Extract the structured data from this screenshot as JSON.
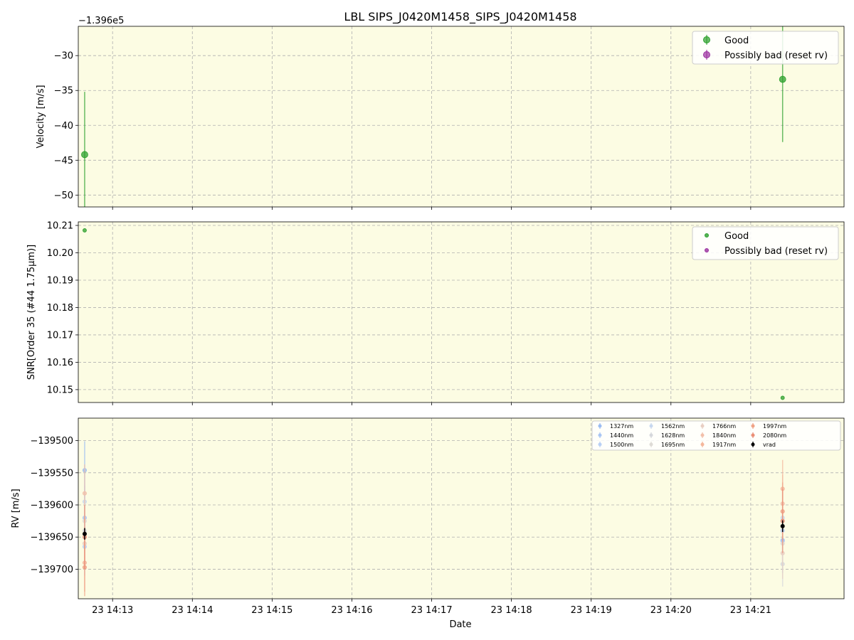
{
  "title": "LBL SIPS_J0420M1458_SIPS_J0420M1458",
  "xlabel": "Date",
  "x_ticks": [
    "23 14:13",
    "23 14:14",
    "23 14:15",
    "23 14:16",
    "23 14:17",
    "23 14:18",
    "23 14:19",
    "23 14:20",
    "23 14:21"
  ],
  "colors": {
    "background": "#fcfce3",
    "good": "#2ca02c",
    "bad": "#9b30a0",
    "grid": "#b0b0b0",
    "vrad": "#000000"
  },
  "chart_data": [
    {
      "type": "scatter",
      "ylabel": "Velocity [m/s]",
      "offset_label": "−1.396e5",
      "ylim": [
        -51.7,
        -25.8
      ],
      "xlim_minutes": [
        -0.43,
        9.17
      ],
      "yticks": [
        -50,
        -45,
        -40,
        -35,
        -30
      ],
      "ytick_labels": [
        "−50",
        "−45",
        "−40",
        "−35",
        "−30"
      ],
      "grid": true,
      "legend": {
        "placement": "top-right",
        "entries": [
          "Good",
          "Possibly bad (reset rv)"
        ]
      },
      "series": [
        {
          "name": "Good",
          "x": [
            "14:12:39",
            "14:21:24"
          ],
          "y": [
            -44.2,
            -33.4
          ],
          "yerr": [
            9.0,
            9.0
          ]
        },
        {
          "name": "Possibly bad (reset rv)",
          "x": [],
          "y": [],
          "yerr": []
        }
      ]
    },
    {
      "type": "scatter",
      "ylabel": "SNR[Order 35 (#44 1.75μm)]",
      "ylim": [
        10.1453,
        10.2113
      ],
      "yticks": [
        10.15,
        10.16,
        10.17,
        10.18,
        10.19,
        10.2,
        10.21
      ],
      "ytick_labels": [
        "10.15",
        "10.16",
        "10.17",
        "10.18",
        "10.19",
        "10.20",
        "10.21"
      ],
      "grid": true,
      "legend": {
        "placement": "top-right",
        "entries": [
          "Good",
          "Possibly bad (reset rv)"
        ]
      },
      "series": [
        {
          "name": "Good",
          "x": [
            "14:12:39",
            "14:21:24"
          ],
          "y": [
            10.2082,
            10.147
          ]
        },
        {
          "name": "Possibly bad (reset rv)",
          "x": [],
          "y": []
        }
      ]
    },
    {
      "type": "scatter",
      "ylabel": "RV [m/s]",
      "ylim": [
        -139746,
        -139465
      ],
      "yticks": [
        -139700,
        -139650,
        -139600,
        -139550,
        -139500
      ],
      "ytick_labels": [
        "−139700",
        "−139650",
        "−139600",
        "−139550",
        "−139500"
      ],
      "grid": true,
      "legend": {
        "placement": "top-right",
        "columns": 5
      },
      "series": [
        {
          "name": "1327nm",
          "color": "#9bbcf2",
          "x": [
            "14:12:39",
            "14:21:24"
          ],
          "y": [
            -139546,
            -139655
          ],
          "yerr": [
            45,
            45
          ]
        },
        {
          "name": "1440nm",
          "color": "#aac6f4",
          "x": [
            "14:12:39",
            "14:21:24"
          ],
          "y": [
            -139620,
            -139656
          ],
          "yerr": [
            50,
            50
          ]
        },
        {
          "name": "1500nm",
          "color": "#b9d0f5",
          "x": [
            "14:12:39",
            "14:21:24"
          ],
          "y": [
            -139665,
            -139640
          ],
          "yerr": [
            45,
            45
          ]
        },
        {
          "name": "1562nm",
          "color": "#c8d8ef",
          "x": [
            "14:12:39",
            "14:21:24"
          ],
          "y": [
            -139595,
            -139620
          ],
          "yerr": [
            40,
            40
          ]
        },
        {
          "name": "1628nm",
          "color": "#d6d8dc",
          "x": [
            "14:12:39",
            "14:21:24"
          ],
          "y": [
            -139640,
            -139692
          ],
          "yerr": [
            35,
            35
          ]
        },
        {
          "name": "1695nm",
          "color": "#dedbd6",
          "x": [
            "14:12:39",
            "14:21:24"
          ],
          "y": [
            -139625,
            -139660
          ],
          "yerr": [
            35,
            35
          ]
        },
        {
          "name": "1766nm",
          "color": "#e8cfc3",
          "x": [
            "14:12:39",
            "14:21:24"
          ],
          "y": [
            -139660,
            -139675
          ],
          "yerr": [
            40,
            40
          ]
        },
        {
          "name": "1840nm",
          "color": "#f2c0aa",
          "x": [
            "14:12:39",
            "14:21:24"
          ],
          "y": [
            -139582,
            -139598
          ],
          "yerr": [
            45,
            45
          ]
        },
        {
          "name": "1917nm",
          "color": "#f4b79c",
          "x": [
            "14:12:39",
            "14:21:24"
          ],
          "y": [
            -139690,
            -139575
          ],
          "yerr": [
            45,
            45
          ]
        },
        {
          "name": "1997nm",
          "color": "#f0a387",
          "x": [
            "14:12:39",
            "14:21:24"
          ],
          "y": [
            -139697,
            -139610
          ],
          "yerr": [
            45,
            45
          ]
        },
        {
          "name": "2080nm",
          "color": "#ea8f77",
          "x": [
            "14:12:39",
            "14:21:24"
          ],
          "y": [
            -139650,
            -139625
          ],
          "yerr": [
            50,
            50
          ]
        },
        {
          "name": "vrad",
          "color": "#000000",
          "x": [
            "14:12:39",
            "14:21:24"
          ],
          "y": [
            -139645,
            -139633
          ],
          "yerr": [
            9,
            9
          ]
        }
      ]
    }
  ]
}
